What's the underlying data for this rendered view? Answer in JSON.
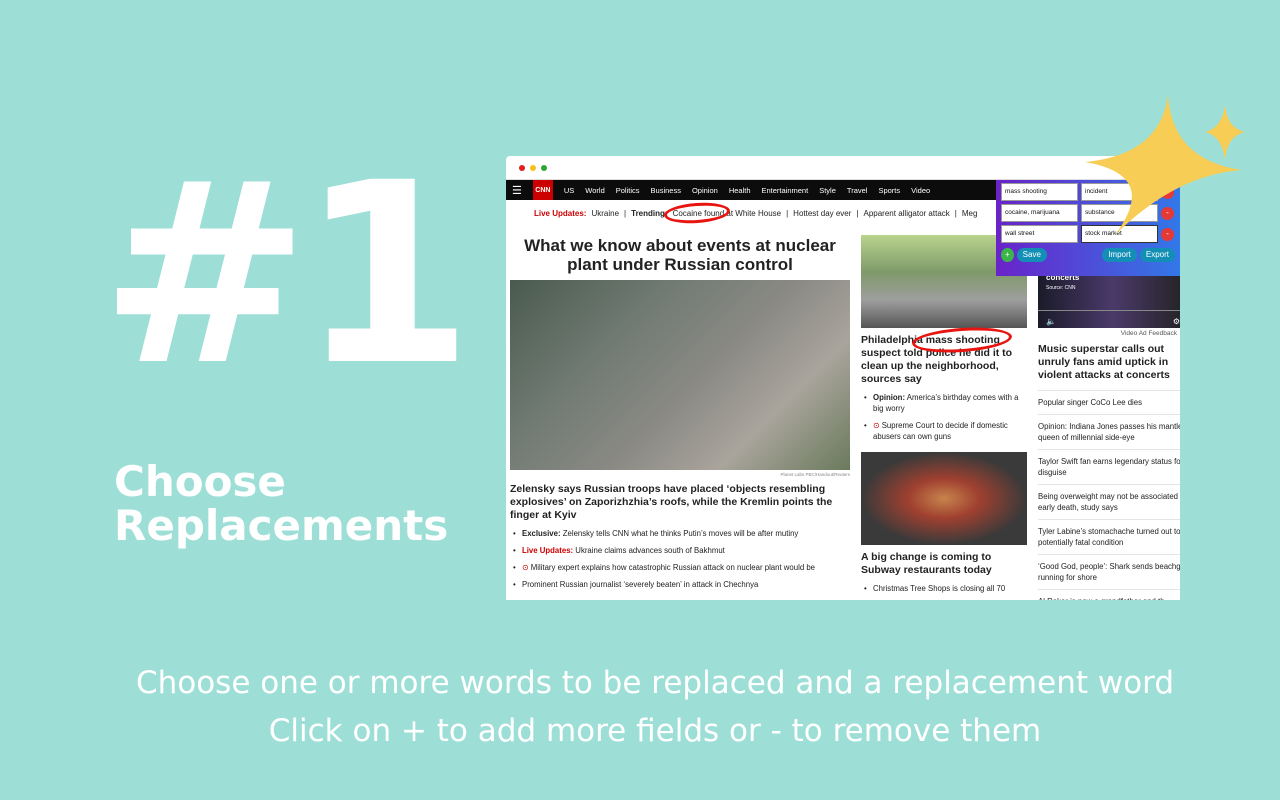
{
  "promo": {
    "number": "#1",
    "title_line1": "Choose",
    "title_line2": "Replacements",
    "caption1": "Choose one or more words to be replaced and a replacement word",
    "caption2": "Click on + to add more fields or - to remove them"
  },
  "colors": {
    "background": "#9ddfd7",
    "cnn_red": "#cc0000",
    "sparkle": "#f7cd55"
  },
  "nav": {
    "logo": "CNN",
    "items": [
      "US",
      "World",
      "Politics",
      "Business",
      "Opinion",
      "Health",
      "Entertainment",
      "Style",
      "Travel",
      "Sports",
      "Video"
    ]
  },
  "trending": {
    "live_label": "Live Updates:",
    "live_text": "Ukraine",
    "trend_label": "Trending:",
    "items": [
      "Cocaine found at White House",
      "Hottest day ever",
      "Apparent alligator attack",
      "Meg"
    ]
  },
  "main": {
    "headline": "What we know about events at nuclear plant under Russian control",
    "credit": "Planet Labs PBC/Handout/Reuters",
    "story": "Zelensky says Russian troops have placed ‘objects resembling explosives’ on Zaporizhzhia’s roofs, while the Kremlin points the finger at Kyiv",
    "bullets": [
      {
        "bold": "Exclusive:",
        "text": " Zelensky tells CNN what he thinks Putin’s moves will be after mutiny"
      },
      {
        "red": "Live Updates:",
        "text": " Ukraine claims advances south of Bakhmut"
      },
      {
        "video": true,
        "text": " Military expert explains how catastrophic Russian attack on nuclear plant would be"
      },
      {
        "text": "Prominent Russian journalist ‘severely beaten’ in attack in Chechnya"
      }
    ]
  },
  "middle": {
    "story1": "Philadelphia mass shooting suspect told police he did it to clean up the neighborhood, sources say",
    "bullets": [
      {
        "bold": "Opinion:",
        "text": " America’s birthday comes with a big worry"
      },
      {
        "video": true,
        "text": " Supreme Court to decide if domestic abusers can own guns"
      }
    ],
    "story2": "A big change is coming to Subway restaurants today",
    "bullets2": [
      "Christmas Tree Shops is closing all 70"
    ]
  },
  "right": {
    "video_title": "concerts",
    "video_source": "Source: CNN",
    "ad_label": "Video Ad Feedback",
    "headline": "Music superstar calls out unruly fans amid uptick in violent attacks at concerts",
    "items": [
      "Popular singer CoCo Lee dies",
      "Opinion: Indiana Jones passes his mantle to queen of millennial side-eye",
      "Taylor Swift fan earns legendary status for disguise",
      "Being overweight may not be associated with early death, study says",
      "Tyler Labine’s stomachache turned out to be a potentially fatal condition",
      "‘Good God, people’: Shark sends beachgoers running for shore",
      "Al Roker is now a grandfather and th"
    ]
  },
  "popup": {
    "rows": [
      {
        "find": "mass shooting",
        "replace": "incident"
      },
      {
        "find": "cocaine, marijuana",
        "replace": "substance"
      },
      {
        "find": "wall street",
        "replace": "stock market"
      }
    ],
    "add": "+",
    "remove": "-",
    "save": "Save",
    "import": "Import",
    "export": "Export"
  }
}
